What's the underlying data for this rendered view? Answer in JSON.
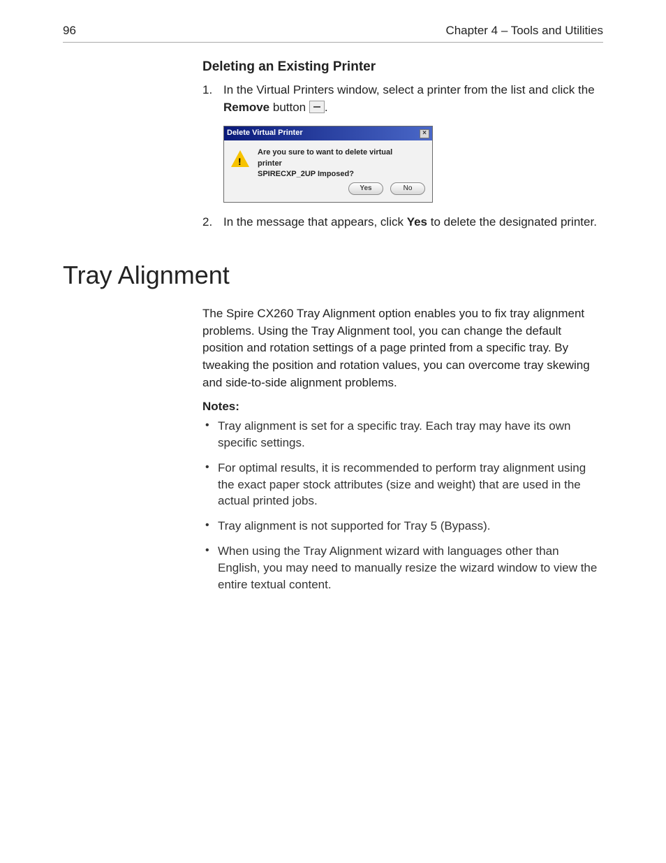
{
  "header": {
    "page_num": "96",
    "chapter": "Chapter 4 – Tools and Utilities"
  },
  "section1": {
    "title": "Deleting an Existing Printer",
    "step1_a": "In the Virtual Printers window, select a printer from the list and click the ",
    "step1_b": "Remove",
    "step1_c": " button ",
    "step1_d": ".",
    "step2_a": "In the message that appears, click ",
    "step2_b": "Yes",
    "step2_c": " to delete the designated printer."
  },
  "dialog": {
    "title": "Delete Virtual Printer",
    "line1": "Are you sure to want to delete virtual printer",
    "line2": "SPIRECXP_2UP Imposed?",
    "yes": "Yes",
    "no": "No",
    "close": "×"
  },
  "section2": {
    "title": "Tray Alignment",
    "para": "The Spire CX260 Tray Alignment option enables you to fix tray alignment problems. Using the Tray Alignment tool, you can change the default position and rotation settings of a page printed from a specific tray. By tweaking the position and rotation values, you can overcome tray skewing and side-to-side alignment problems.",
    "notes_label": "Notes:",
    "notes": [
      "Tray alignment is set for a specific tray. Each tray may have its own specific settings.",
      "For optimal results, it is recommended to perform tray alignment using the exact paper stock attributes (size and weight) that are used in the actual printed jobs.",
      "Tray alignment is not supported for Tray 5 (Bypass).",
      "When using the Tray Alignment wizard with languages other than English, you may need to manually resize the wizard window to view the entire textual content."
    ]
  }
}
